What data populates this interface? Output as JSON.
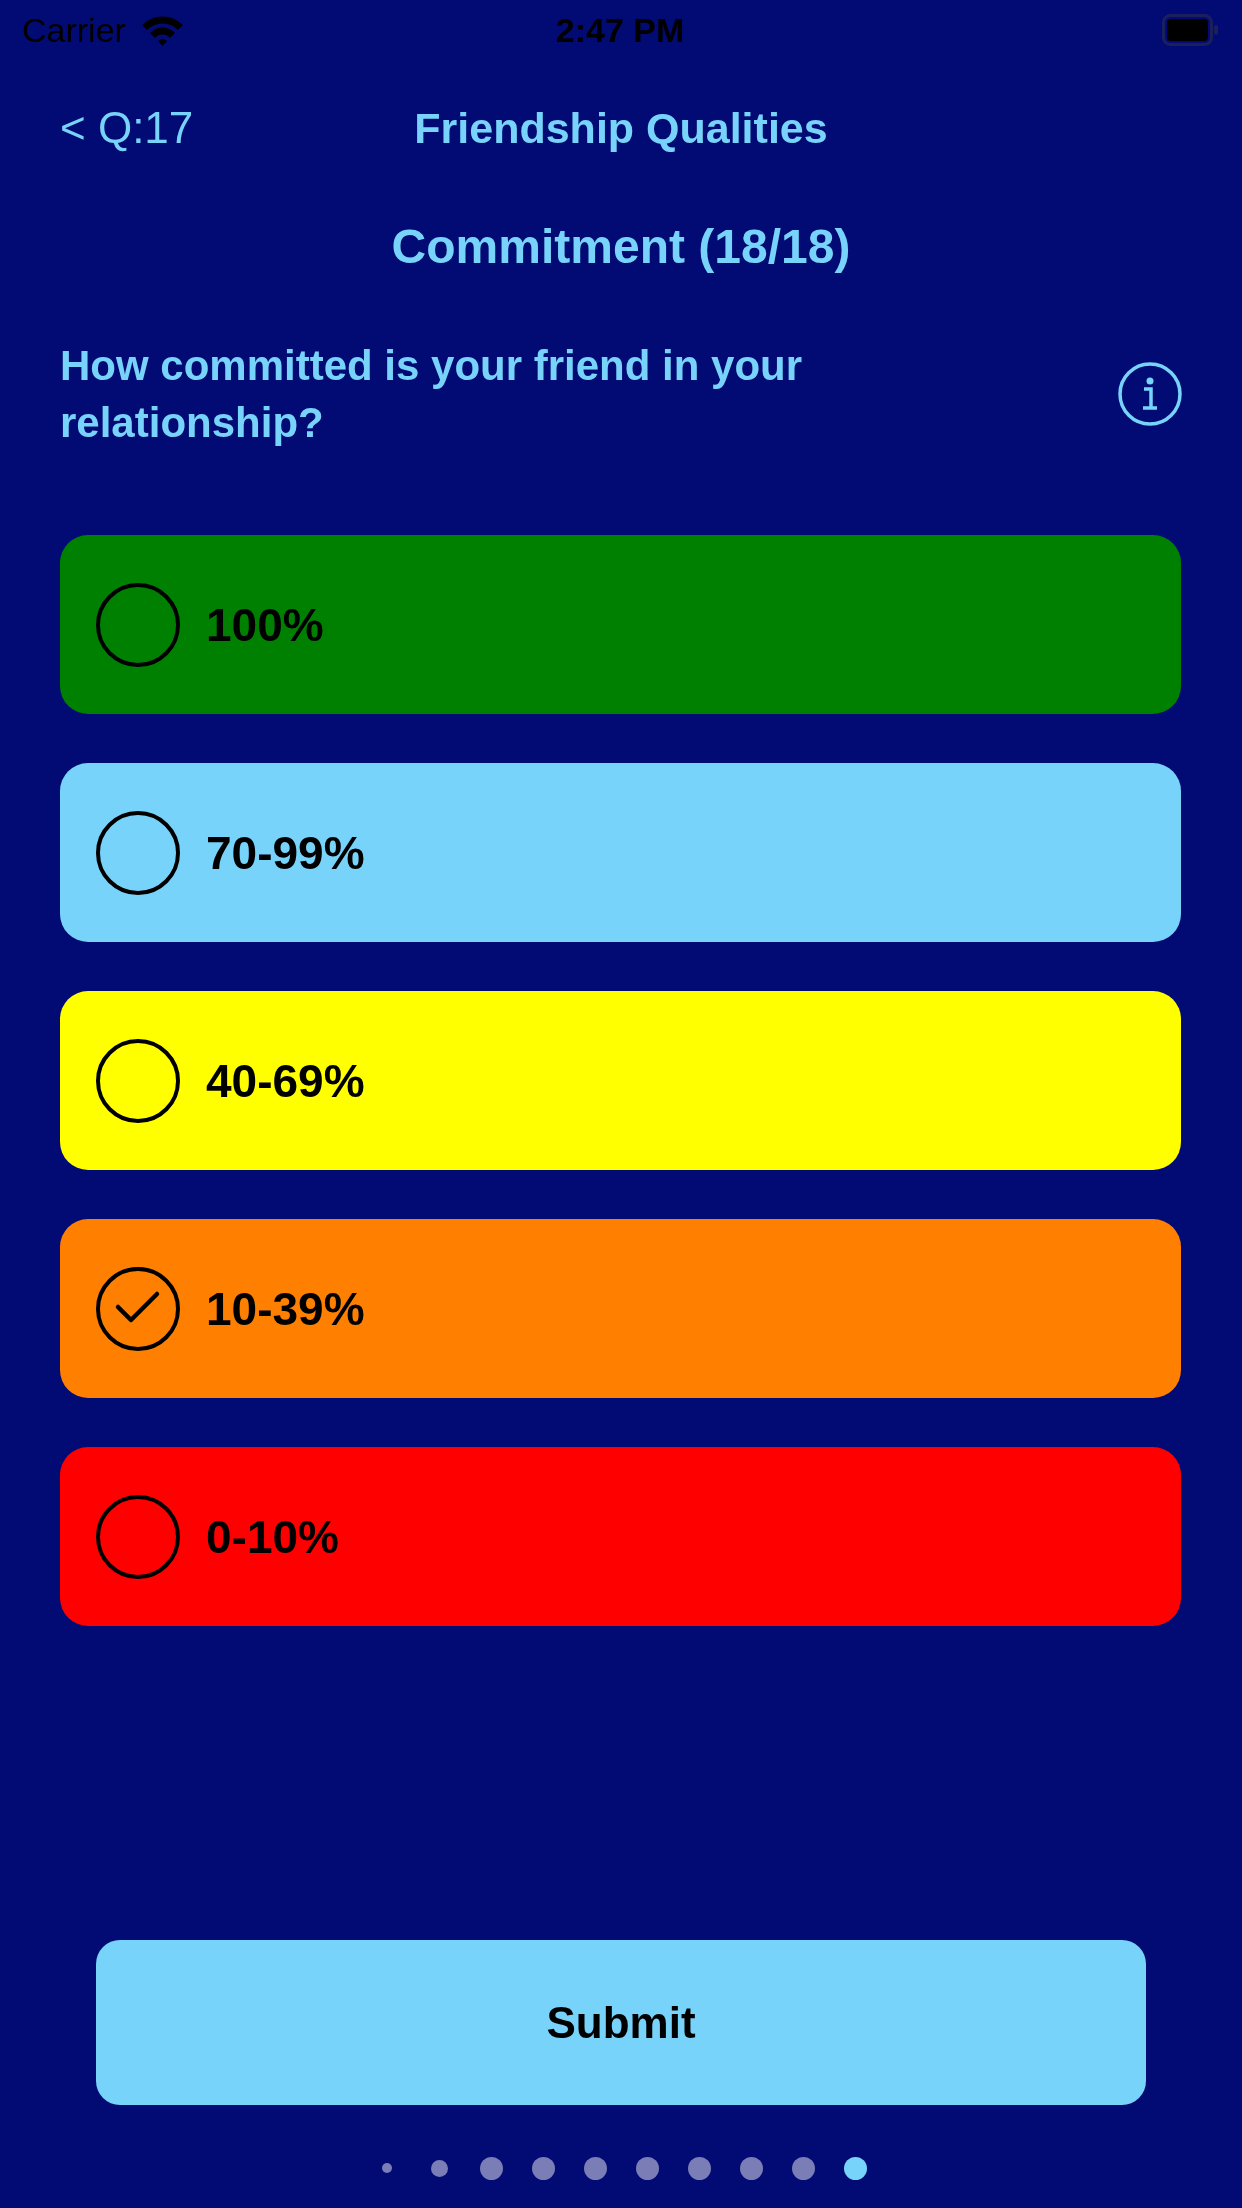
{
  "status_bar": {
    "carrier": "Carrier",
    "time": "2:47 PM"
  },
  "nav": {
    "back": "< Q:17",
    "title": "Friendship Qualities"
  },
  "heading": "Commitment (18/18)",
  "question": "How committed is your friend in your relationship?",
  "options": [
    {
      "label": "100%",
      "color": "#008000",
      "selected": false
    },
    {
      "label": "70-99%",
      "color": "#78d3fa",
      "selected": false
    },
    {
      "label": "40-69%",
      "color": "#ffff00",
      "selected": false
    },
    {
      "label": "10-39%",
      "color": "#ff8000",
      "selected": true
    },
    {
      "label": "0-10%",
      "color": "#ff0000",
      "selected": false
    }
  ],
  "submit": "Submit",
  "page_dots": [
    {
      "kind": "tiny",
      "selected": false
    },
    {
      "kind": "small",
      "selected": false
    },
    {
      "kind": "regular",
      "selected": false
    },
    {
      "kind": "regular",
      "selected": false
    },
    {
      "kind": "regular",
      "selected": false
    },
    {
      "kind": "regular",
      "selected": false
    },
    {
      "kind": "regular",
      "selected": false
    },
    {
      "kind": "regular",
      "selected": false
    },
    {
      "kind": "regular",
      "selected": false
    },
    {
      "kind": "regular",
      "selected": true
    }
  ]
}
